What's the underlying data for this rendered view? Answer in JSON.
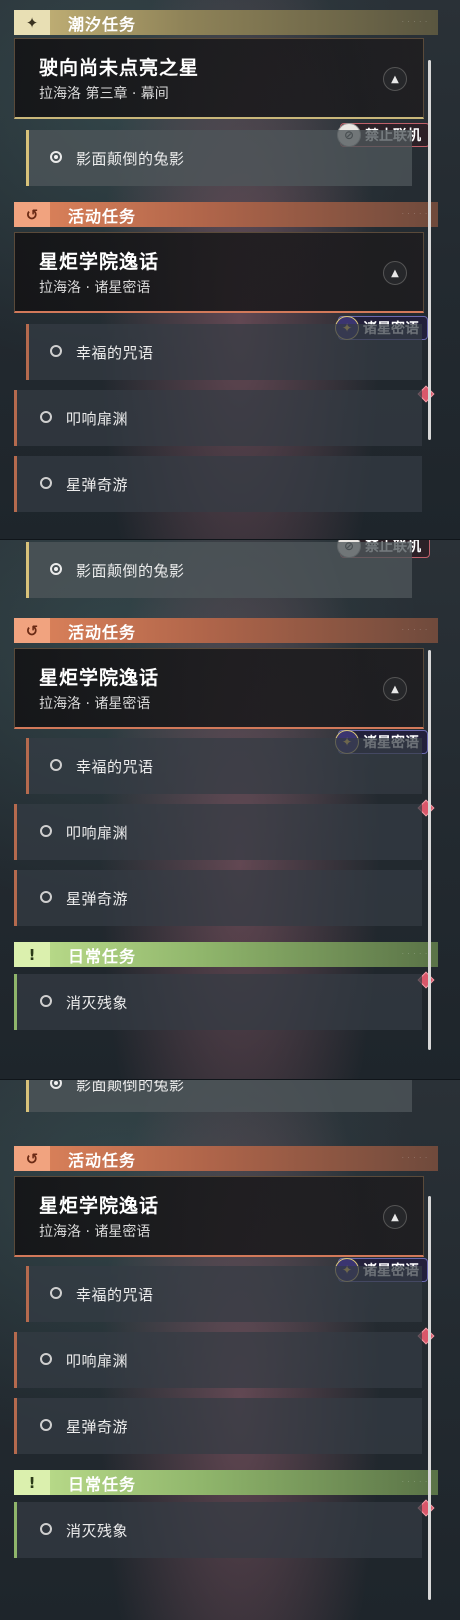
{
  "categories": {
    "tide": {
      "label": "潮汐任务",
      "icon": "✦"
    },
    "event": {
      "label": "活动任务",
      "icon": "↺"
    },
    "daily": {
      "label": "日常任务",
      "icon": "!"
    }
  },
  "tide_quest": {
    "title": "驶向尚未点亮之星",
    "subtitle": "拉海洛 第三章 · 幕间"
  },
  "event_quest": {
    "title": "星炬学院逸话",
    "subtitle": "拉海洛 · 诸星密语"
  },
  "badges": {
    "no_coop": "禁止联机",
    "star_whisper": "诸星密语"
  },
  "subquests": {
    "rabbit": "影面颠倒的兔影",
    "happy": "幸福的咒语",
    "echo": "叩响扉渊",
    "star": "星弹奇游",
    "daily": "消灭残象"
  },
  "icons": {
    "collapse": "chevron-up-icon",
    "selected": "radio-selected-icon",
    "unselected": "radio-icon",
    "alert": "diamond-marker-icon"
  }
}
